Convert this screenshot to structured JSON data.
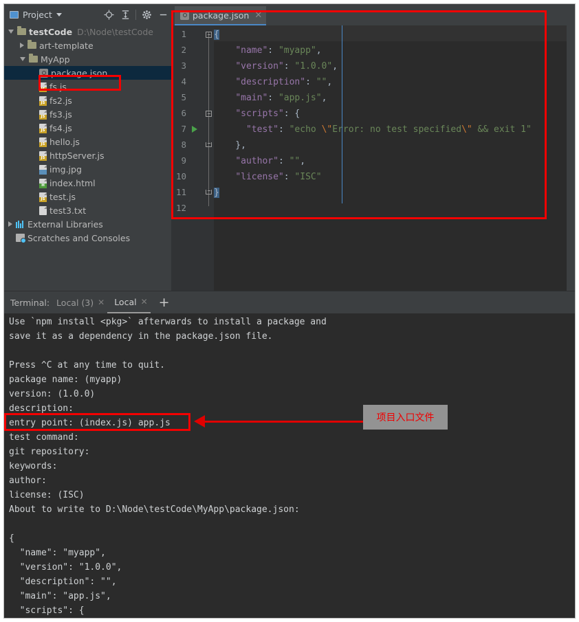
{
  "toolbar": {
    "project_label": "Project",
    "icons": [
      "project-window-icon",
      "chevron-down-icon",
      "locate-target-icon",
      "collapse-all-icon",
      "settings-gear-icon",
      "minimize-icon"
    ]
  },
  "tree": {
    "items": [
      {
        "label": "testCode",
        "path": "D:\\Node\\testCode",
        "icon": "folder-icon",
        "arrow": "open",
        "indent": 0,
        "bold": true,
        "selected": false
      },
      {
        "label": "art-template",
        "path": "",
        "icon": "folder-icon",
        "arrow": "closed",
        "indent": 1,
        "bold": false,
        "selected": false
      },
      {
        "label": "MyApp",
        "path": "",
        "icon": "folder-icon",
        "arrow": "open",
        "indent": 1,
        "bold": false,
        "selected": false
      },
      {
        "label": "package.json",
        "path": "",
        "icon": "package-json-icon",
        "arrow": "none",
        "indent": 2,
        "bold": false,
        "selected": true
      },
      {
        "label": "fs.js",
        "path": "",
        "icon": "js-file-icon",
        "arrow": "none",
        "indent": 2,
        "bold": false,
        "selected": false
      },
      {
        "label": "fs2.js",
        "path": "",
        "icon": "js-file-icon",
        "arrow": "none",
        "indent": 2,
        "bold": false,
        "selected": false
      },
      {
        "label": "fs3.js",
        "path": "",
        "icon": "js-file-icon",
        "arrow": "none",
        "indent": 2,
        "bold": false,
        "selected": false
      },
      {
        "label": "fs4.js",
        "path": "",
        "icon": "js-file-icon",
        "arrow": "none",
        "indent": 2,
        "bold": false,
        "selected": false
      },
      {
        "label": "hello.js",
        "path": "",
        "icon": "js-file-icon",
        "arrow": "none",
        "indent": 2,
        "bold": false,
        "selected": false
      },
      {
        "label": "httpServer.js",
        "path": "",
        "icon": "js-file-icon",
        "arrow": "none",
        "indent": 2,
        "bold": false,
        "selected": false
      },
      {
        "label": "img.jpg",
        "path": "",
        "icon": "image-file-icon",
        "arrow": "none",
        "indent": 2,
        "bold": false,
        "selected": false
      },
      {
        "label": "index.html",
        "path": "",
        "icon": "html-file-icon",
        "arrow": "none",
        "indent": 2,
        "bold": false,
        "selected": false
      },
      {
        "label": "test.js",
        "path": "",
        "icon": "js-file-icon",
        "arrow": "none",
        "indent": 2,
        "bold": false,
        "selected": false
      },
      {
        "label": "test3.txt",
        "path": "",
        "icon": "text-file-icon",
        "arrow": "none",
        "indent": 2,
        "bold": false,
        "selected": false
      },
      {
        "label": "External Libraries",
        "path": "",
        "icon": "libraries-icon",
        "arrow": "closed",
        "indent": 0,
        "bold": false,
        "selected": false
      },
      {
        "label": "Scratches and Consoles",
        "path": "",
        "icon": "scratches-icon",
        "arrow": "none",
        "indent": 0,
        "bold": false,
        "selected": false
      }
    ]
  },
  "editor": {
    "tab": {
      "label": "package.json",
      "icon": "package-json-icon",
      "close_icon": "close-icon"
    },
    "line_numbers": [
      "1",
      "2",
      "3",
      "4",
      "5",
      "6",
      "7",
      "8",
      "9",
      "10",
      "11",
      "12"
    ],
    "run_marker_line": 7,
    "code_lines": [
      "{",
      "    \"name\": \"myapp\",",
      "    \"version\": \"1.0.0\",",
      "    \"description\": \"\",",
      "    \"main\": \"app.js\",",
      "    \"scripts\": {",
      "      \"test\": \"echo \\\"Error: no test specified\\\" && exit 1\"",
      "    },",
      "    \"author\": \"\",",
      "    \"license\": \"ISC\"",
      "}",
      ""
    ]
  },
  "terminal": {
    "title": "Terminal:",
    "tabs": [
      {
        "label": "Local (3)",
        "active": false,
        "close_icon": "close-icon"
      },
      {
        "label": "Local",
        "active": true,
        "close_icon": "close-icon"
      }
    ],
    "add_label": "+",
    "output": [
      "Use `npm install <pkg>` afterwards to install a package and",
      "save it as a dependency in the package.json file.",
      "",
      "Press ^C at any time to quit.",
      "package name: (myapp)",
      "version: (1.0.0)",
      "description:",
      "entry point: (index.js) app.js",
      "test command:",
      "git repository:",
      "keywords:",
      "author:",
      "license: (ISC)",
      "About to write to D:\\Node\\testCode\\MyApp\\package.json:",
      "",
      "{",
      "  \"name\": \"myapp\",",
      "  \"version\": \"1.0.0\",",
      "  \"description\": \"\",",
      "  \"main\": \"app.js\",",
      "  \"scripts\": {"
    ]
  },
  "annotations": {
    "callout_text": "项目入口文件",
    "callout_color": "#ef0000",
    "box_color": "#f40000"
  }
}
